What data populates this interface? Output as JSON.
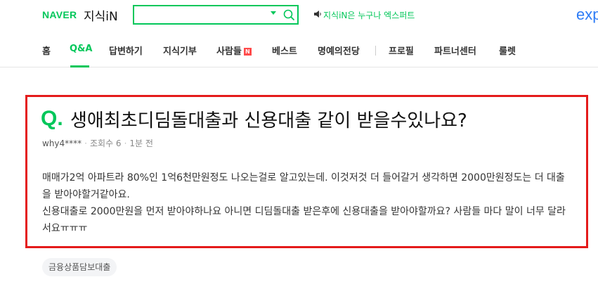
{
  "header": {
    "brand": "NAVER",
    "service": "지식iN",
    "search_value": "",
    "notice": "지식iN은 누구나 엑스퍼트",
    "expert_logo": "exp",
    "accent_color": "#03c75a"
  },
  "nav": {
    "items": [
      {
        "label": "홈"
      },
      {
        "label": "Q&A",
        "active": true
      },
      {
        "label": "답변하기"
      },
      {
        "label": "지식기부"
      },
      {
        "label": "사람들",
        "badge": "N"
      },
      {
        "label": "베스트"
      },
      {
        "label": "명예의전당"
      },
      {
        "label": "프로필"
      },
      {
        "label": "파트너센터"
      },
      {
        "label": "룰렛"
      }
    ]
  },
  "question": {
    "mark": "Q.",
    "title": "생애최초디딤돌대출과 신용대출 같이 받을수있나요?",
    "author": "why4****",
    "views": "조회수 6",
    "time": "1분 전",
    "body_lines": [
      "매매가2억 아파트라 80%인 1억6천만원정도 나오는걸로 알고있는데. 이것저것 더 들어갈거 생각하면 2000만원정도는 더 대출을 받아야할거같아요.",
      "신용대출로 2000만원을 먼저 받아야하나요 아니면 디딤돌대출 받은후에 신용대출을 받아야할까요? 사람들 마다 말이 너무 달라서요ㅠㅠㅠ"
    ]
  },
  "tags": [
    "금융상품담보대출"
  ]
}
